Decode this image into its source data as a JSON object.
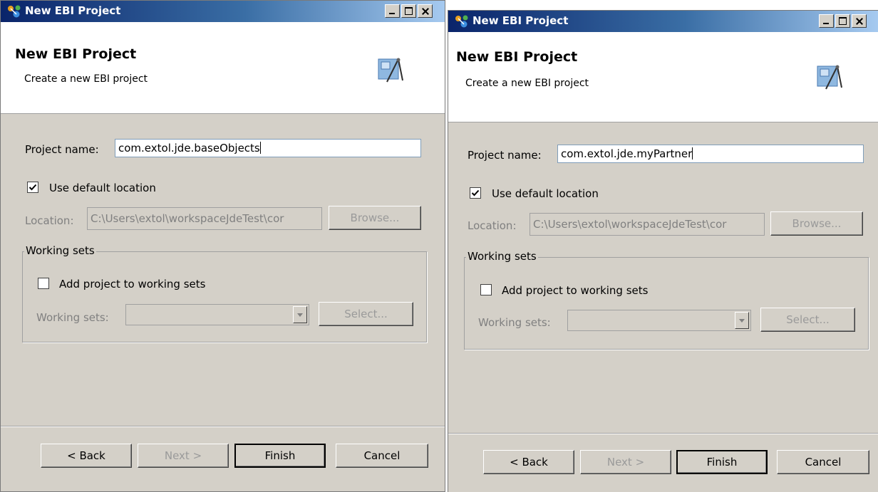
{
  "dialogs": [
    {
      "window_title": "New EBI Project",
      "banner": {
        "title": "New EBI Project",
        "description": "Create a new EBI project"
      },
      "project_name_label": "Project name:",
      "project_name_value": "com.extol.jde.baseObjects",
      "use_default_location": {
        "label": "Use default location",
        "checked": true
      },
      "location_label": "Location:",
      "location_value": "C:\\Users\\extol\\workspaceJdeTest\\cor",
      "browse_label": "Browse...",
      "working_sets_group": "Working sets",
      "add_to_working_sets": {
        "label": "Add project to working sets",
        "checked": false
      },
      "working_sets_label": "Working sets:",
      "select_label": "Select...",
      "buttons": {
        "back": "< Back",
        "next": "Next >",
        "finish": "Finish",
        "cancel": "Cancel"
      }
    },
    {
      "window_title": "New EBI Project",
      "banner": {
        "title": "New EBI Project",
        "description": "Create a new EBI project"
      },
      "project_name_label": "Project name:",
      "project_name_value": "com.extol.jde.myPartner",
      "use_default_location": {
        "label": "Use default location",
        "checked": true
      },
      "location_label": "Location:",
      "location_value": "C:\\Users\\extol\\workspaceJdeTest\\cor",
      "browse_label": "Browse...",
      "working_sets_group": "Working sets",
      "add_to_working_sets": {
        "label": "Add project to working sets",
        "checked": false
      },
      "working_sets_label": "Working sets:",
      "select_label": "Select...",
      "buttons": {
        "back": "< Back",
        "next": "Next >",
        "finish": "Finish",
        "cancel": "Cancel"
      }
    }
  ],
  "colors": {
    "titlebar_start": "#0a246a",
    "titlebar_end": "#a6caf0",
    "dialog_face": "#d4d0c8",
    "disabled_text": "#808080"
  },
  "icons": {
    "app": "ebi-app-icon",
    "banner": "wizard-drafting-icon"
  }
}
